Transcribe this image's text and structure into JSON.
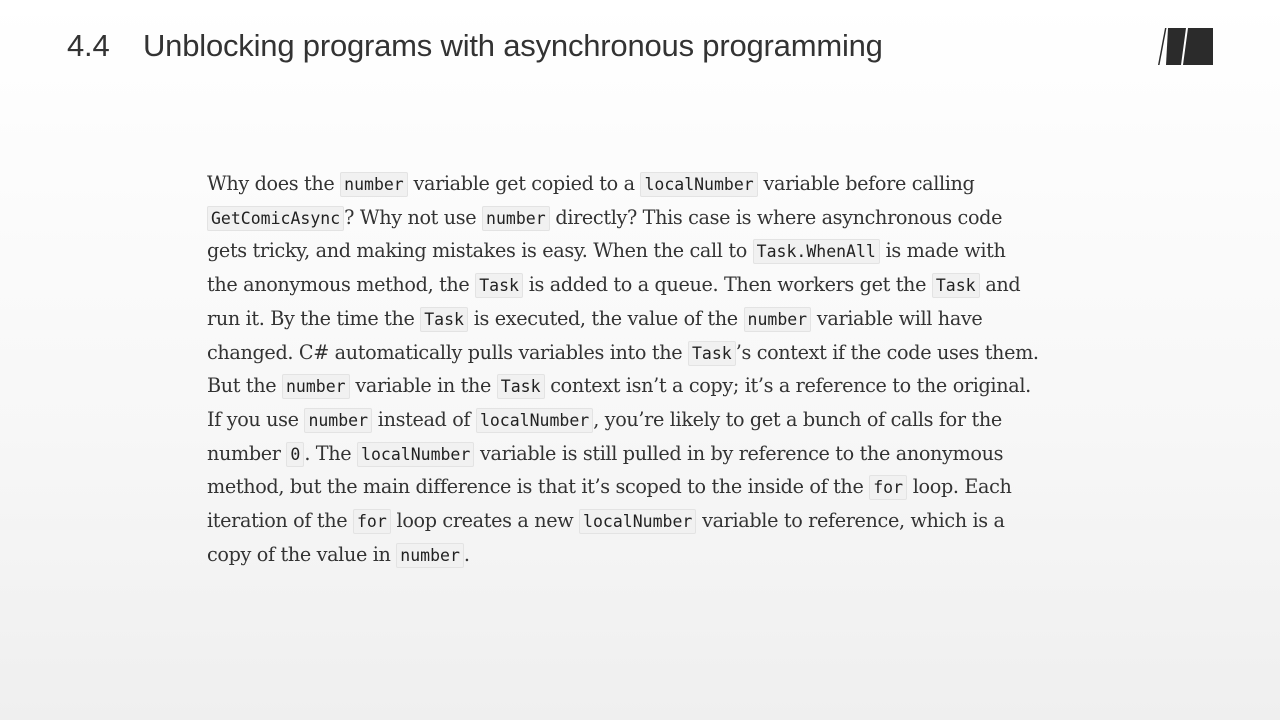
{
  "header": {
    "section_number": "4.4",
    "title": "Unblocking programs with asynchronous programming"
  },
  "logo": {
    "icon": "publisher-m-logo-icon",
    "color": "#2b2b2b"
  },
  "paragraph": {
    "lines": [
      [
        {
          "t": "text",
          "v": "Why does the "
        },
        {
          "t": "code",
          "v": "number"
        },
        {
          "t": "text",
          "v": " variable get copied to a "
        },
        {
          "t": "code",
          "v": "localNumber"
        },
        {
          "t": "text",
          "v": " variable before calling"
        }
      ],
      [
        {
          "t": "code",
          "v": "GetComicAsync"
        },
        {
          "t": "text",
          "v": "? Why not use "
        },
        {
          "t": "code",
          "v": "number"
        },
        {
          "t": "text",
          "v": " directly? This case is where asynchronous code"
        }
      ],
      [
        {
          "t": "text",
          "v": "gets tricky, and making mistakes is easy. When the call to "
        },
        {
          "t": "code",
          "v": "Task.WhenAll"
        },
        {
          "t": "text",
          "v": " is made with"
        }
      ],
      [
        {
          "t": "text",
          "v": "the anonymous method, the "
        },
        {
          "t": "code",
          "v": "Task"
        },
        {
          "t": "text",
          "v": " is added to a queue. Then workers get the "
        },
        {
          "t": "code",
          "v": "Task"
        },
        {
          "t": "text",
          "v": " and"
        }
      ],
      [
        {
          "t": "text",
          "v": "run it. By the time the "
        },
        {
          "t": "code",
          "v": "Task"
        },
        {
          "t": "text",
          "v": " is executed, the value of the "
        },
        {
          "t": "code",
          "v": "number"
        },
        {
          "t": "text",
          "v": " variable will have"
        }
      ],
      [
        {
          "t": "text",
          "v": "changed. C# automatically pulls variables into the "
        },
        {
          "t": "code",
          "v": "Task"
        },
        {
          "t": "text",
          "v": "’s context if the code uses them."
        }
      ],
      [
        {
          "t": "text",
          "v": "But the "
        },
        {
          "t": "code",
          "v": "number"
        },
        {
          "t": "text",
          "v": " variable in the "
        },
        {
          "t": "code",
          "v": "Task"
        },
        {
          "t": "text",
          "v": " context isn’t a copy; it’s a reference to the original."
        }
      ],
      [
        {
          "t": "text",
          "v": "If you use "
        },
        {
          "t": "code",
          "v": "number"
        },
        {
          "t": "text",
          "v": " instead of "
        },
        {
          "t": "code",
          "v": "localNumber"
        },
        {
          "t": "text",
          "v": ", you’re likely to get a bunch of calls for the"
        }
      ],
      [
        {
          "t": "text",
          "v": "number "
        },
        {
          "t": "code",
          "v": "0"
        },
        {
          "t": "text",
          "v": ". The "
        },
        {
          "t": "code",
          "v": "localNumber"
        },
        {
          "t": "text",
          "v": " variable is still pulled in by reference to the anonymous"
        }
      ],
      [
        {
          "t": "text",
          "v": "method, but the main difference is that it’s scoped to the inside of the "
        },
        {
          "t": "code",
          "v": "for"
        },
        {
          "t": "text",
          "v": " loop. Each"
        }
      ],
      [
        {
          "t": "text",
          "v": "iteration of the "
        },
        {
          "t": "code",
          "v": "for"
        },
        {
          "t": "text",
          "v": " loop creates a new "
        },
        {
          "t": "code",
          "v": "localNumber"
        },
        {
          "t": "text",
          "v": " variable to reference, which is a"
        }
      ],
      [
        {
          "t": "text",
          "v": "copy of the value in "
        },
        {
          "t": "code",
          "v": "number"
        },
        {
          "t": "text",
          "v": "."
        }
      ]
    ]
  }
}
